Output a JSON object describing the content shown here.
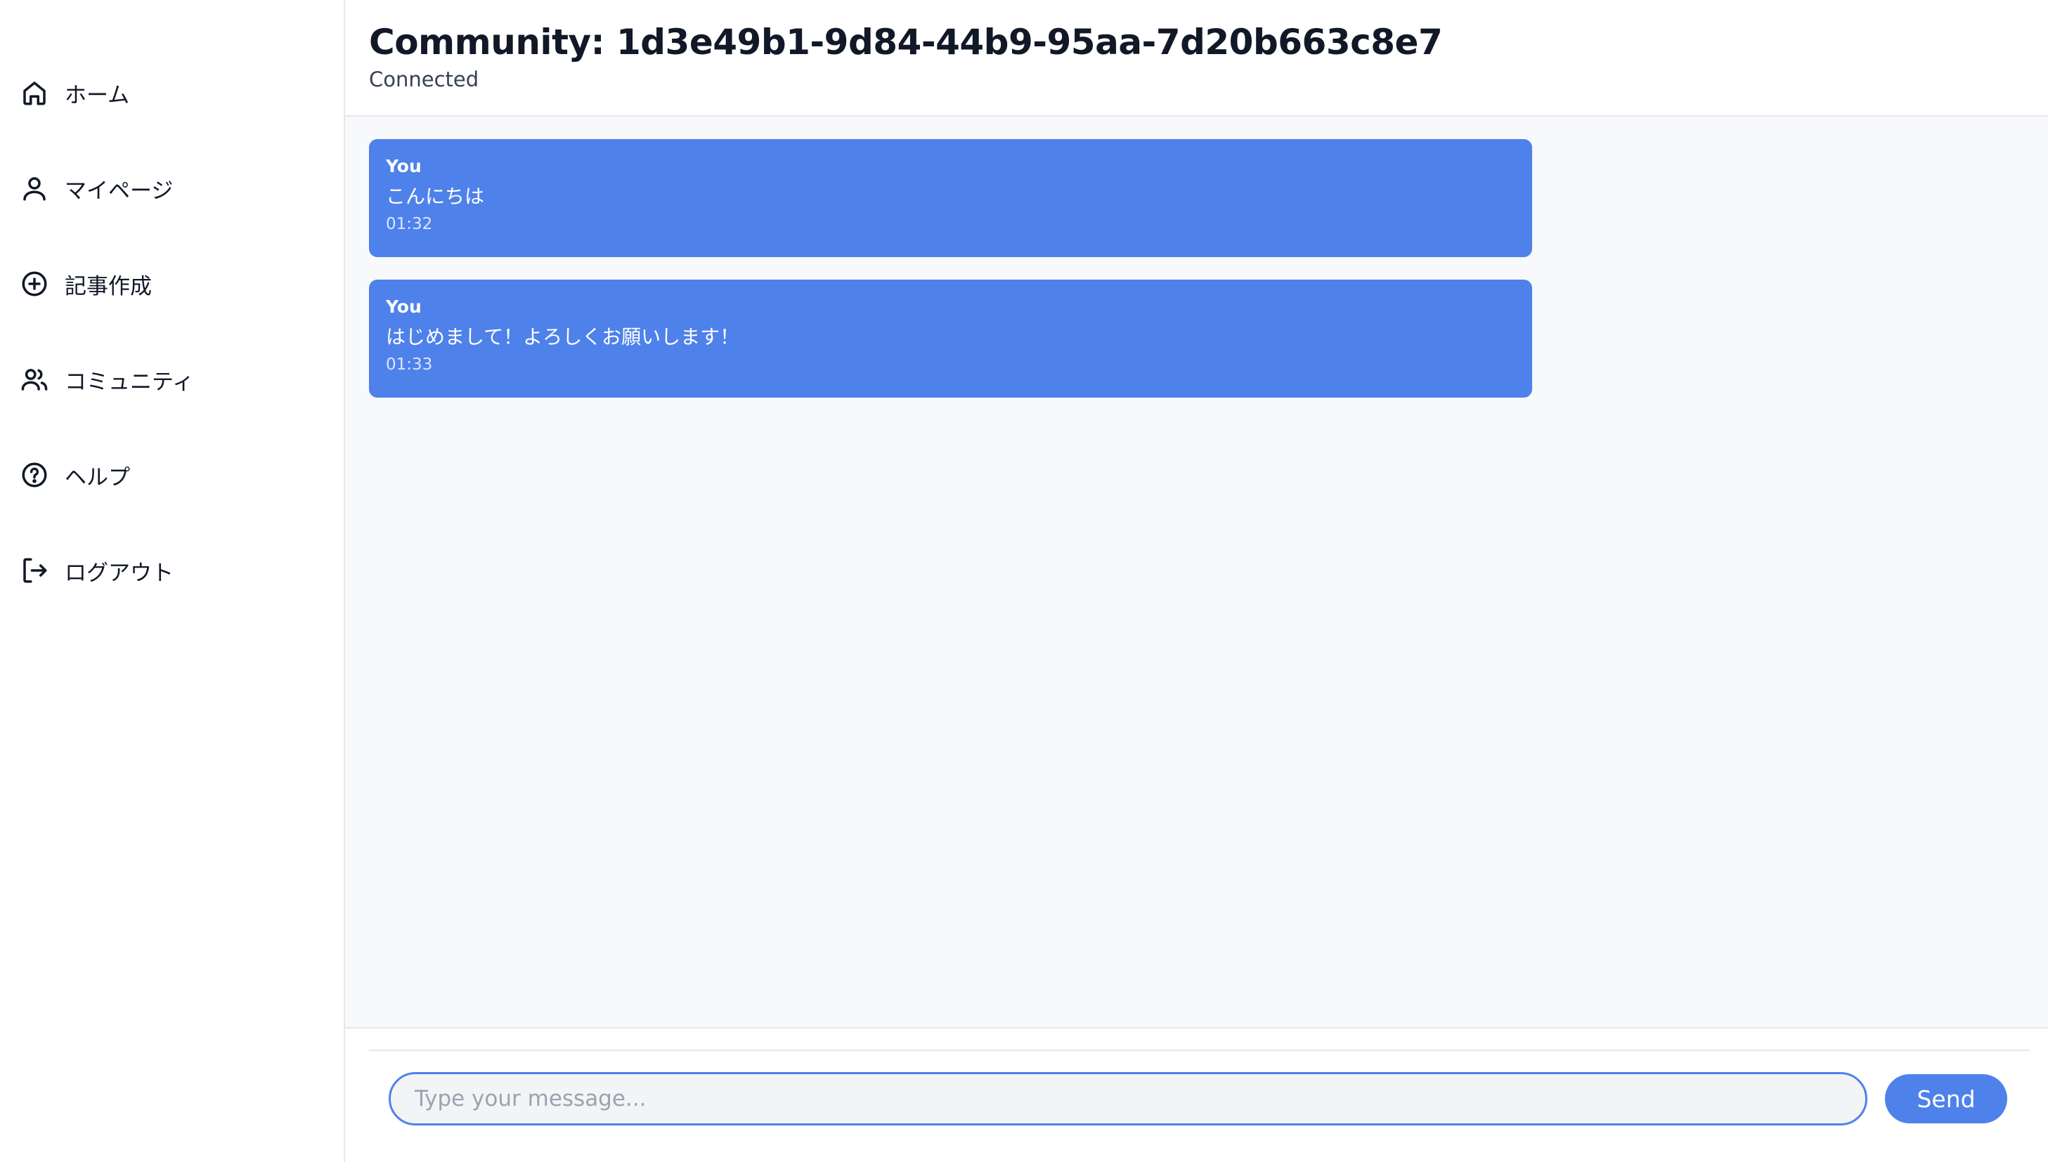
{
  "sidebar": {
    "items": [
      {
        "label": "ホーム",
        "icon": "home-icon"
      },
      {
        "label": "マイページ",
        "icon": "user-icon"
      },
      {
        "label": "記事作成",
        "icon": "plus-circle-icon"
      },
      {
        "label": "コミュニティ",
        "icon": "users-icon"
      },
      {
        "label": "ヘルプ",
        "icon": "help-circle-icon"
      },
      {
        "label": "ログアウト",
        "icon": "logout-icon"
      }
    ]
  },
  "header": {
    "title": "Community: 1d3e49b1-9d84-44b9-95aa-7d20b663c8e7",
    "status": "Connected"
  },
  "messages": [
    {
      "sender": "You",
      "text": "こんにちは",
      "time": "01:32"
    },
    {
      "sender": "You",
      "text": "はじめまして！よろしくお願いします！",
      "time": "01:33"
    }
  ],
  "composer": {
    "placeholder": "Type your message...",
    "value": "",
    "send_label": "Send"
  },
  "colors": {
    "accent": "#4f81ea",
    "background": "#f8f9fb"
  }
}
